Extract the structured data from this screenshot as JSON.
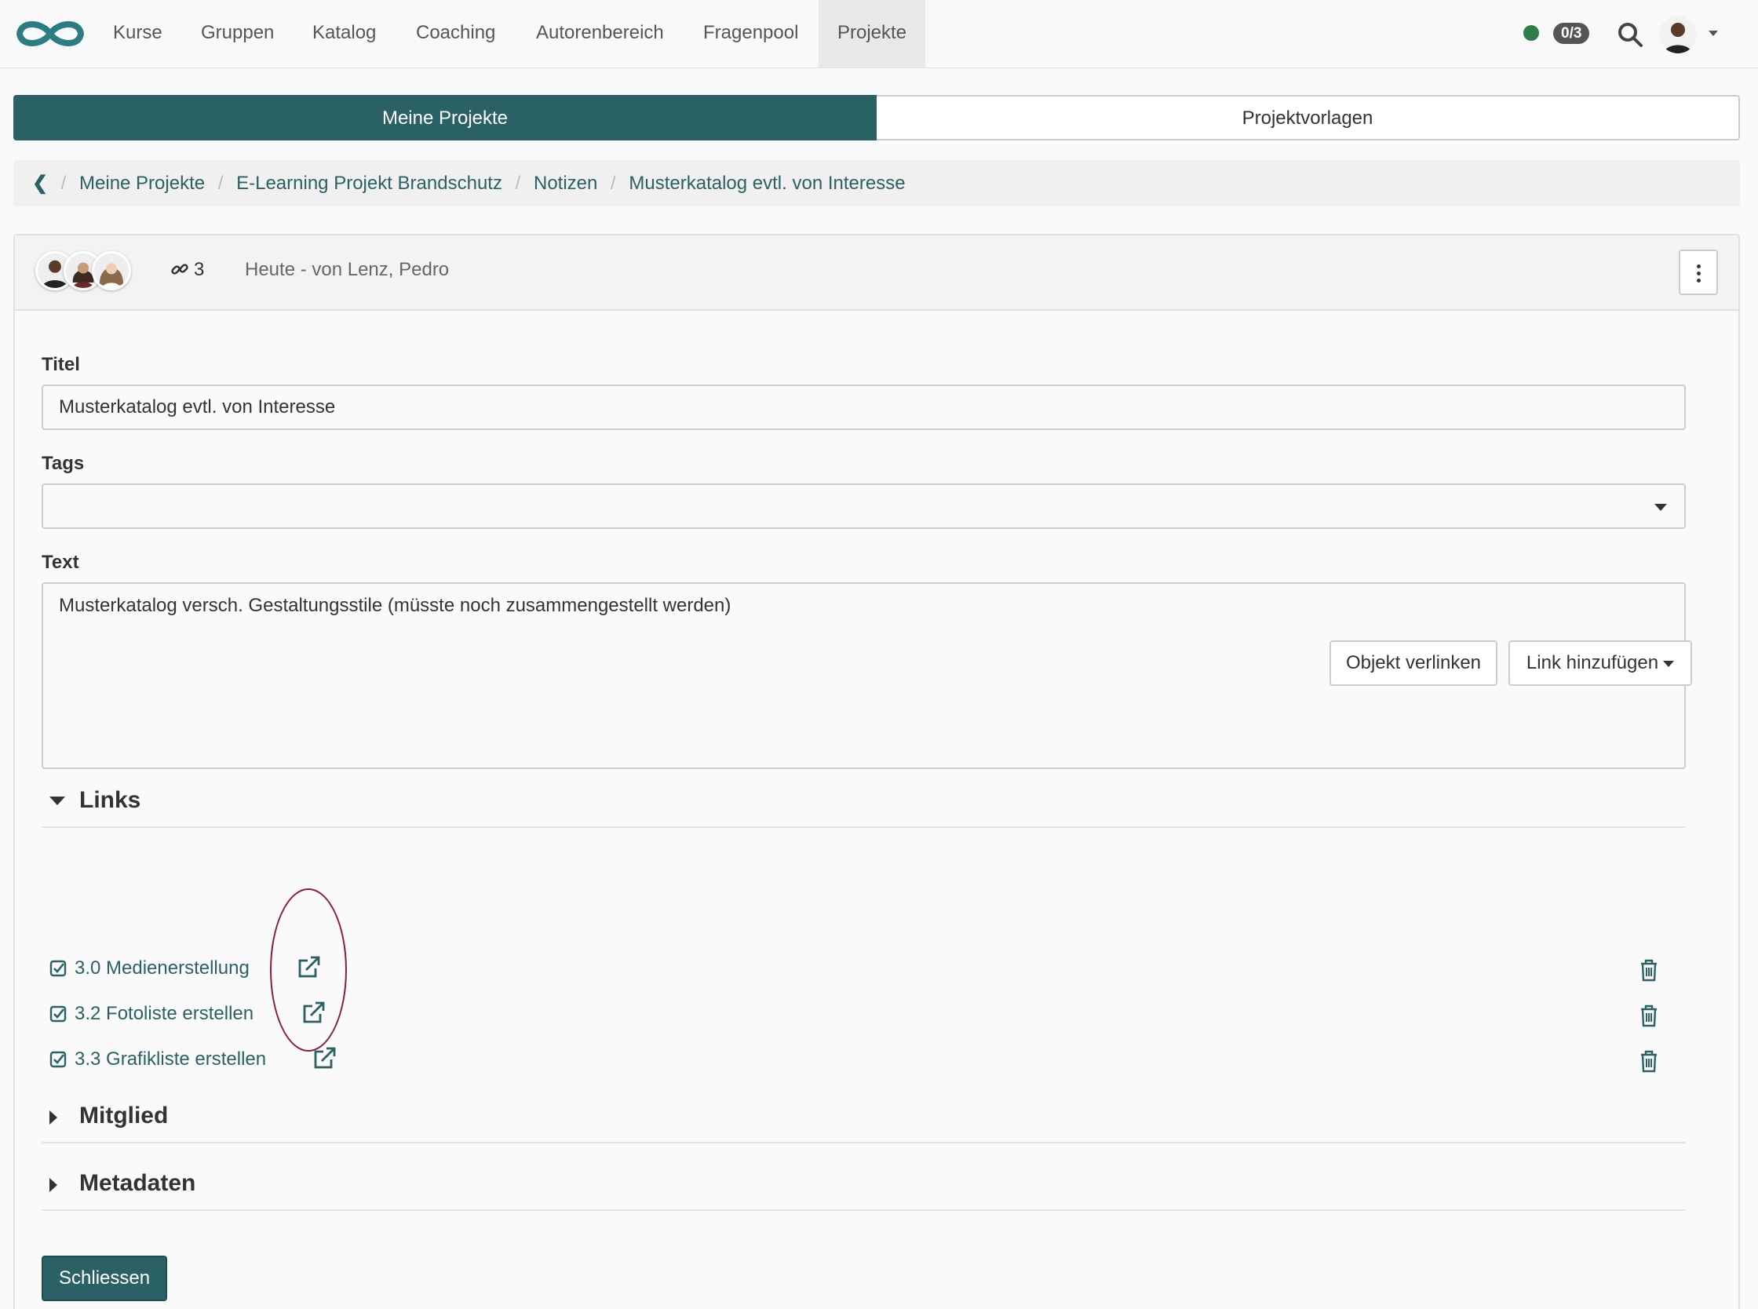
{
  "nav": {
    "items": [
      "Kurse",
      "Gruppen",
      "Katalog",
      "Coaching",
      "Autorenbereich",
      "Fragenpool",
      "Projekte"
    ],
    "active": "Projekte",
    "status_badge": "0/3",
    "status_color": "#2e7d4a"
  },
  "tabs": {
    "my_projects": "Meine Projekte",
    "templates": "Projektvorlagen"
  },
  "breadcrumb": [
    "Meine Projekte",
    "E-Learning Projekt Brandschutz",
    "Notizen",
    "Musterkatalog evtl. von Interesse"
  ],
  "header": {
    "link_count": "3",
    "meta": "Heute - von Lenz, Pedro"
  },
  "form": {
    "title_label": "Titel",
    "title_value": "Musterkatalog evtl. von Interesse",
    "tags_label": "Tags",
    "tags_value": "",
    "text_label": "Text",
    "text_value": "Musterkatalog versch. Gestaltungsstile (müsste noch zusammengestellt werden)"
  },
  "links_section": {
    "title": "Links",
    "link_object_button": "Objekt verlinken",
    "add_link_button": "Link hinzufügen",
    "items": [
      "3.0 Medienerstellung",
      "3.2 Fotoliste erstellen",
      "3.3 Grafikliste erstellen"
    ]
  },
  "member_section": {
    "title": "Mitglied"
  },
  "metadata_section": {
    "title": "Metadaten"
  },
  "close_button": "Schliessen",
  "colors": {
    "primary": "#2a6165",
    "highlight": "#8c1a3a"
  }
}
